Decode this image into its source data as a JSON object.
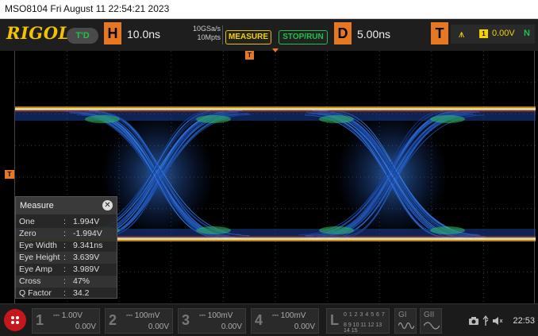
{
  "title_bar": {
    "text": "MSO8104   Fri August 11 22:54:21 2023"
  },
  "toolbar": {
    "logo": "RIGOL",
    "mode_badge": "T'D",
    "horizontal": {
      "letter": "H",
      "timebase": "10.0ns",
      "sample_rate": "10GSa/s",
      "memory_depth": "10Mpts"
    },
    "measure_label": "MEASURE",
    "stop_run_label": "STOP/RUN",
    "delay": {
      "letter": "D",
      "value": "5.00ns"
    },
    "trigger": {
      "letter": "T",
      "edge_icon": "rising-edge-icon",
      "source": "1",
      "level": "0.00V",
      "mode": "N"
    }
  },
  "markers": {
    "trigger_position": "T",
    "trigger_level": "T"
  },
  "measure_panel": {
    "title": "Measure",
    "rows": [
      {
        "name": "One",
        "value": "1.994V"
      },
      {
        "name": "Zero",
        "value": "-1.994V"
      },
      {
        "name": "Eye Width",
        "value": "9.341ns"
      },
      {
        "name": "Eye Height",
        "value": "3.639V"
      },
      {
        "name": "Eye Amp",
        "value": "3.989V"
      },
      {
        "name": "Cross",
        "value": "47%"
      },
      {
        "name": "Q Factor",
        "value": "34.2"
      }
    ]
  },
  "channels": [
    {
      "num": "1",
      "scale": "1.00V",
      "offset": "0.00V"
    },
    {
      "num": "2",
      "scale": "100mV",
      "offset": "0.00V"
    },
    {
      "num": "3",
      "scale": "100mV",
      "offset": "0.00V"
    },
    {
      "num": "4",
      "scale": "100mV",
      "offset": "0.00V"
    }
  ],
  "logic": {
    "letter": "L",
    "row1": "0 1 2 3  4 5 6 7",
    "row2": "8 9 10 11 12 13 14 15"
  },
  "generators": [
    {
      "label": "GI",
      "icon": "sine-wave-icon"
    },
    {
      "label": "GII",
      "icon": "sine-wave-icon"
    }
  ],
  "status": {
    "time": "22:53",
    "icons": [
      "camera-icon",
      "usb-icon",
      "speaker-icon"
    ]
  },
  "colors": {
    "accent_orange": "#e87722",
    "rigol_yellow": "#f2c200",
    "channel1_yellow": "#f2d200",
    "run_green": "#1ec24a",
    "eye_blue": "#1a4aa8",
    "home_red": "#c8161d"
  }
}
